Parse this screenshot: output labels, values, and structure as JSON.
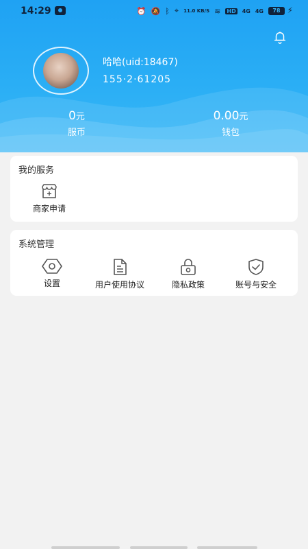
{
  "status_bar": {
    "time": "14:29",
    "network_speed": "11.0 KB/S",
    "hd_label": "HD",
    "signal_1": "4G",
    "signal_2": "4G",
    "battery": "78"
  },
  "profile": {
    "username": "哈哈(uid:18467)",
    "phone": "155·2·61205",
    "coins_value": "0",
    "coins_unit": "元",
    "coins_label": "服币",
    "wallet_value": "0.00",
    "wallet_unit": "元",
    "wallet_label": "钱包"
  },
  "my_services": {
    "title": "我的服务",
    "items": [
      {
        "label": "商家申请",
        "icon": "shop-icon"
      }
    ]
  },
  "system_management": {
    "title": "系统管理",
    "items": [
      {
        "label": "设置",
        "icon": "settings-icon"
      },
      {
        "label": "用户使用协议",
        "icon": "document-icon"
      },
      {
        "label": "隐私政策",
        "icon": "lock-icon"
      },
      {
        "label": "账号与安全",
        "icon": "shield-check-icon"
      }
    ]
  },
  "colors": {
    "header_blue": "#1fa2f3",
    "background": "#f2f2f2",
    "card": "#ffffff"
  }
}
